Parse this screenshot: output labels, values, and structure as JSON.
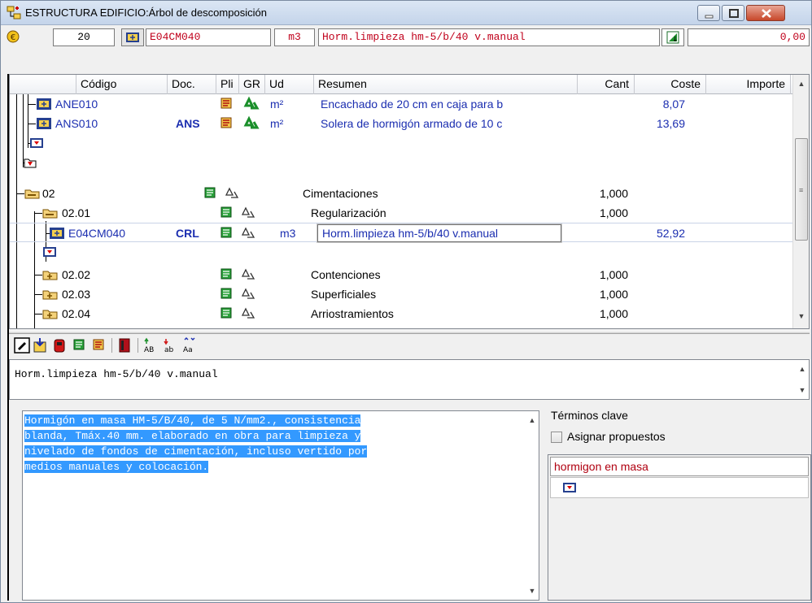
{
  "window": {
    "title": "ESTRUCTURA EDIFICIO:Árbol de descomposición",
    "icons": [
      "tree-structure-icon",
      "minimize-icon",
      "maximize-icon",
      "close-icon"
    ]
  },
  "header": {
    "quantity": "20",
    "code": "E04CM040",
    "unit": "m3",
    "summary": "Horm.limpieza hm-5/b/40 v.manual",
    "total": "0,00"
  },
  "grid": {
    "columns": [
      "Código",
      "Doc.",
      "Pli",
      "GR",
      "Ud",
      "Resumen",
      "Cant",
      "Coste",
      "Importe"
    ],
    "rows": [
      {
        "code": "ANE010",
        "doc": "",
        "unit": "m²",
        "summary": "Encachado de 20 cm en caja para b",
        "qty": "",
        "cost": "8,07",
        "type": "item"
      },
      {
        "code": "ANS010",
        "doc": "ANS",
        "unit": "m²",
        "summary": "Solera de hormigón armado de 10 c",
        "qty": "",
        "cost": "13,69",
        "type": "item"
      },
      {
        "code": "",
        "doc": "",
        "unit": "",
        "summary": "",
        "qty": "",
        "cost": "",
        "type": "end"
      },
      {
        "code": "",
        "doc": "",
        "unit": "",
        "summary": "",
        "qty": "",
        "cost": "",
        "type": "end-chapter"
      },
      {
        "code": "02",
        "doc": "",
        "unit": "",
        "summary": "Cimentaciones",
        "qty": "1,000",
        "cost": "",
        "type": "chapter-open"
      },
      {
        "code": "02.01",
        "doc": "",
        "unit": "",
        "summary": "Regularización",
        "qty": "1,000",
        "cost": "",
        "type": "chapter-open"
      },
      {
        "code": "E04CM040",
        "doc": "CRL",
        "unit": "m3",
        "summary": "Horm.limpieza hm-5/b/40 v.manual",
        "qty": "",
        "cost": "52,92",
        "type": "item-selected"
      },
      {
        "code": "",
        "doc": "",
        "unit": "",
        "summary": "",
        "qty": "",
        "cost": "",
        "type": "end"
      },
      {
        "code": "02.02",
        "doc": "",
        "unit": "",
        "summary": "Contenciones",
        "qty": "1,000",
        "cost": "",
        "type": "chapter"
      },
      {
        "code": "02.03",
        "doc": "",
        "unit": "",
        "summary": "Superficiales",
        "qty": "1,000",
        "cost": "",
        "type": "chapter"
      },
      {
        "code": "02.04",
        "doc": "",
        "unit": "",
        "summary": "Arriostramientos",
        "qty": "1,000",
        "cost": "",
        "type": "chapter"
      }
    ]
  },
  "editor": {
    "short_text": "Horm.limpieza hm-5/b/40 v.manual",
    "long_text_lines": [
      "Hormigón en masa HM-5/B/40, de 5 N/mm2., consistencia",
      "blanda, Tmáx.40 mm. elaborado en obra para limpieza y",
      "nivelado de fondos de cimentación, incluso vertido por",
      "medios manuales y colocación."
    ]
  },
  "keywords": {
    "title": "Términos clave",
    "assign_label": "Asignar propuestos",
    "assign_checked": false,
    "items": [
      "hormigon en masa"
    ]
  },
  "colors": {
    "accent_blue": "#1b2eb0",
    "header_red": "#c0001b",
    "selection": "#3399ff",
    "green_icon": "#1a8f2a"
  }
}
